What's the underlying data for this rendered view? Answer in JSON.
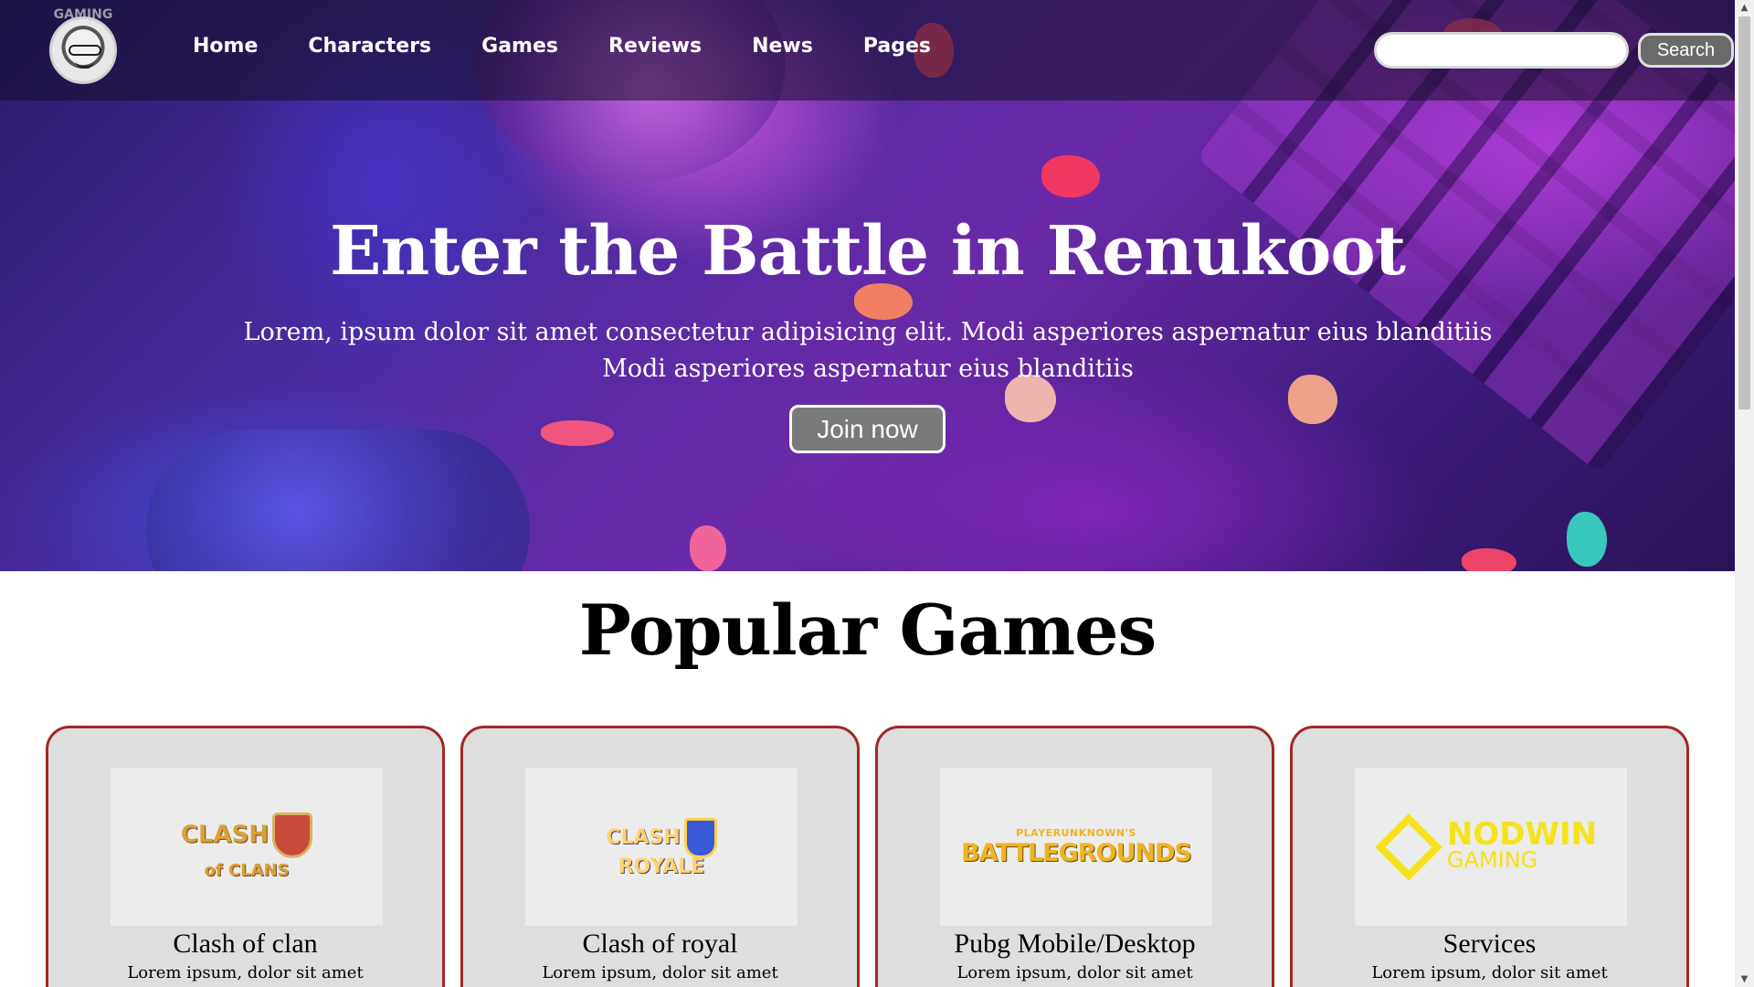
{
  "nav": {
    "logo_text": "GAMING",
    "links": [
      "Home",
      "Characters",
      "Games",
      "Reviews",
      "News",
      "Pages"
    ],
    "search_placeholder": "",
    "search_value": "",
    "search_button": "Search"
  },
  "hero": {
    "title": "Enter the Battle in Renukoot",
    "text": "Lorem, ipsum dolor sit amet consectetur adipisicing elit. Modi asperiores aspernatur eius blanditiis Modi asperiores aspernatur eius blanditiis",
    "button": "Join now"
  },
  "section": {
    "title": "Popular Games",
    "cards": [
      {
        "title": "Clash of clan",
        "text": "Lorem ipsum, dolor sit amet",
        "logo": {
          "line1": "CLASH",
          "line2": "of CLANS"
        }
      },
      {
        "title": "Clash of royal",
        "text": "Lorem ipsum, dolor sit amet",
        "logo": {
          "line1": "CLASH",
          "line2": "ROYALE"
        }
      },
      {
        "title": "Pubg Mobile/Desktop",
        "text": "Lorem ipsum, dolor sit amet",
        "logo": {
          "line1": "PLAYERUNKNOWN'S",
          "line2": "BATTLEGROUNDS"
        }
      },
      {
        "title": "Services",
        "text": "Lorem ipsum, dolor sit amet",
        "logo": {
          "line1": "NODWIN",
          "line2": "GAMING"
        }
      }
    ]
  },
  "colors": {
    "card_border": "#a02828",
    "card_bg": "#dedede",
    "button_gray": "#7a7a7a",
    "hero_purple": "#6a2aa8"
  },
  "icons": {
    "logo": "gamer-avatar-icon",
    "scroll_up": "scroll-up-arrow-icon",
    "scroll_down": "scroll-down-arrow-icon"
  }
}
